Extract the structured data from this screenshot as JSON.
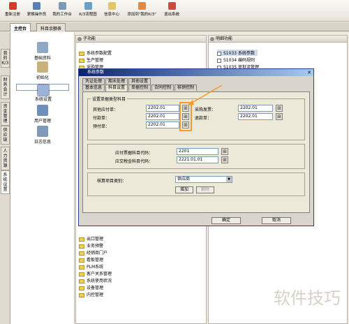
{
  "toolbar": {
    "items": [
      {
        "label": "重新注册",
        "icon": "refresh-icon"
      },
      {
        "label": "更换操作员",
        "icon": "user-switch-icon"
      },
      {
        "label": "我的工作台",
        "icon": "desk-icon"
      },
      {
        "label": "K/3流程图",
        "icon": "flowchart-icon"
      },
      {
        "label": "信息中心",
        "icon": "mail-icon"
      },
      {
        "label": "添加到\"我的K/3\"",
        "icon": "favorite-icon"
      },
      {
        "label": "退出系统",
        "icon": "exit-icon"
      }
    ]
  },
  "tabs": {
    "tab1": "主控台",
    "tab2": "科目余额表"
  },
  "vtabs": [
    "我的K/3",
    "财务会计",
    "资金管理",
    "供应链",
    "人力资源",
    "系统设置"
  ],
  "nav": {
    "items": [
      {
        "label": "基础资料"
      },
      {
        "label": "初始化"
      },
      {
        "label": "系统设置"
      },
      {
        "label": "用户管理"
      },
      {
        "label": "日志信息"
      }
    ]
  },
  "leftpane": {
    "title": "子功能",
    "items": [
      "系统参数配置",
      "生产管理",
      "采购管理"
    ],
    "bottom_items": [
      "出口管理",
      "业务预警",
      "经销商门户",
      "看板管理",
      "PLM系统",
      "客户关系管理",
      "系统使用状况",
      "设备管理",
      "内控管理"
    ]
  },
  "rightpane": {
    "title": "明细功能",
    "items": [
      "S1033  系统参数",
      "S1034  编码规则",
      "S1035  审批流管理"
    ]
  },
  "dialog": {
    "title": "系统参数",
    "tabs_row1": [
      "凭证处理",
      "期末处理",
      "其他设置"
    ],
    "tabs_row2": [
      "基本信息",
      "科目设置",
      "单据控制",
      "合同控制",
      "核销控制"
    ],
    "group1_title": "设置单据类型科目",
    "fields_left": [
      {
        "label": "其他应付单：",
        "value": "2202.01"
      },
      {
        "label": "付款单：",
        "value": "2202.01"
      },
      {
        "label": "预付单：",
        "value": "2202.01"
      }
    ],
    "fields_right": [
      {
        "label": "采购发票：",
        "value": "2202.01"
      },
      {
        "label": "退款单：",
        "value": "2202.01"
      }
    ],
    "fields_mid": [
      {
        "label": "应付票据科目代码：",
        "value": "2201"
      },
      {
        "label": "应交税金科目代码：",
        "value": "2221.01.01"
      }
    ],
    "group2_label": "核算项目类别：",
    "group2_select": "供应商",
    "add_button": "增加",
    "delete_button": "删除",
    "ok_button": "确定",
    "cancel_button": "取消"
  },
  "watermark": "软件技巧",
  "colors": {
    "highlight": "#f39b2d",
    "title_start": "#0b246a",
    "title_end": "#a6caf0"
  }
}
